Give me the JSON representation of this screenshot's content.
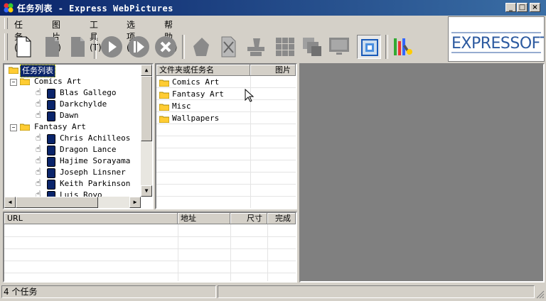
{
  "window": {
    "title": "任务列表 - Express WebPictures"
  },
  "menu": [
    {
      "label": "任务(F)"
    },
    {
      "label": "图片(I)"
    },
    {
      "label": "工具(T)"
    },
    {
      "label": "选项(O)"
    },
    {
      "label": "帮助(H)"
    }
  ],
  "logo": {
    "text": "EXPRESSOFT"
  },
  "tree": {
    "root": "任务列表",
    "groups": [
      {
        "label": "Comics Art",
        "items": [
          "Blas Gallego",
          "Darkchylde",
          "Dawn"
        ]
      },
      {
        "label": "Fantasy Art",
        "items": [
          "Chris Achilleos",
          "Dragon Lance",
          "Hajime Sorayama",
          "Joseph Linsner",
          "Keith Parkinson",
          "Luis Royo"
        ]
      }
    ]
  },
  "folder_list": {
    "headers": [
      "文件夹或任务名",
      "图片"
    ],
    "rows": [
      "Comics Art",
      "Fantasy Art",
      "Misc",
      "Wallpapers"
    ]
  },
  "download_list": {
    "headers": [
      "URL",
      "地址",
      "尺寸",
      "完成"
    ]
  },
  "status": {
    "text": "4 个任务"
  },
  "colors": {
    "title_start": "#0a246a",
    "title_end": "#3a6ea5",
    "preview_bg": "#808080",
    "face": "#d4d0c8"
  }
}
